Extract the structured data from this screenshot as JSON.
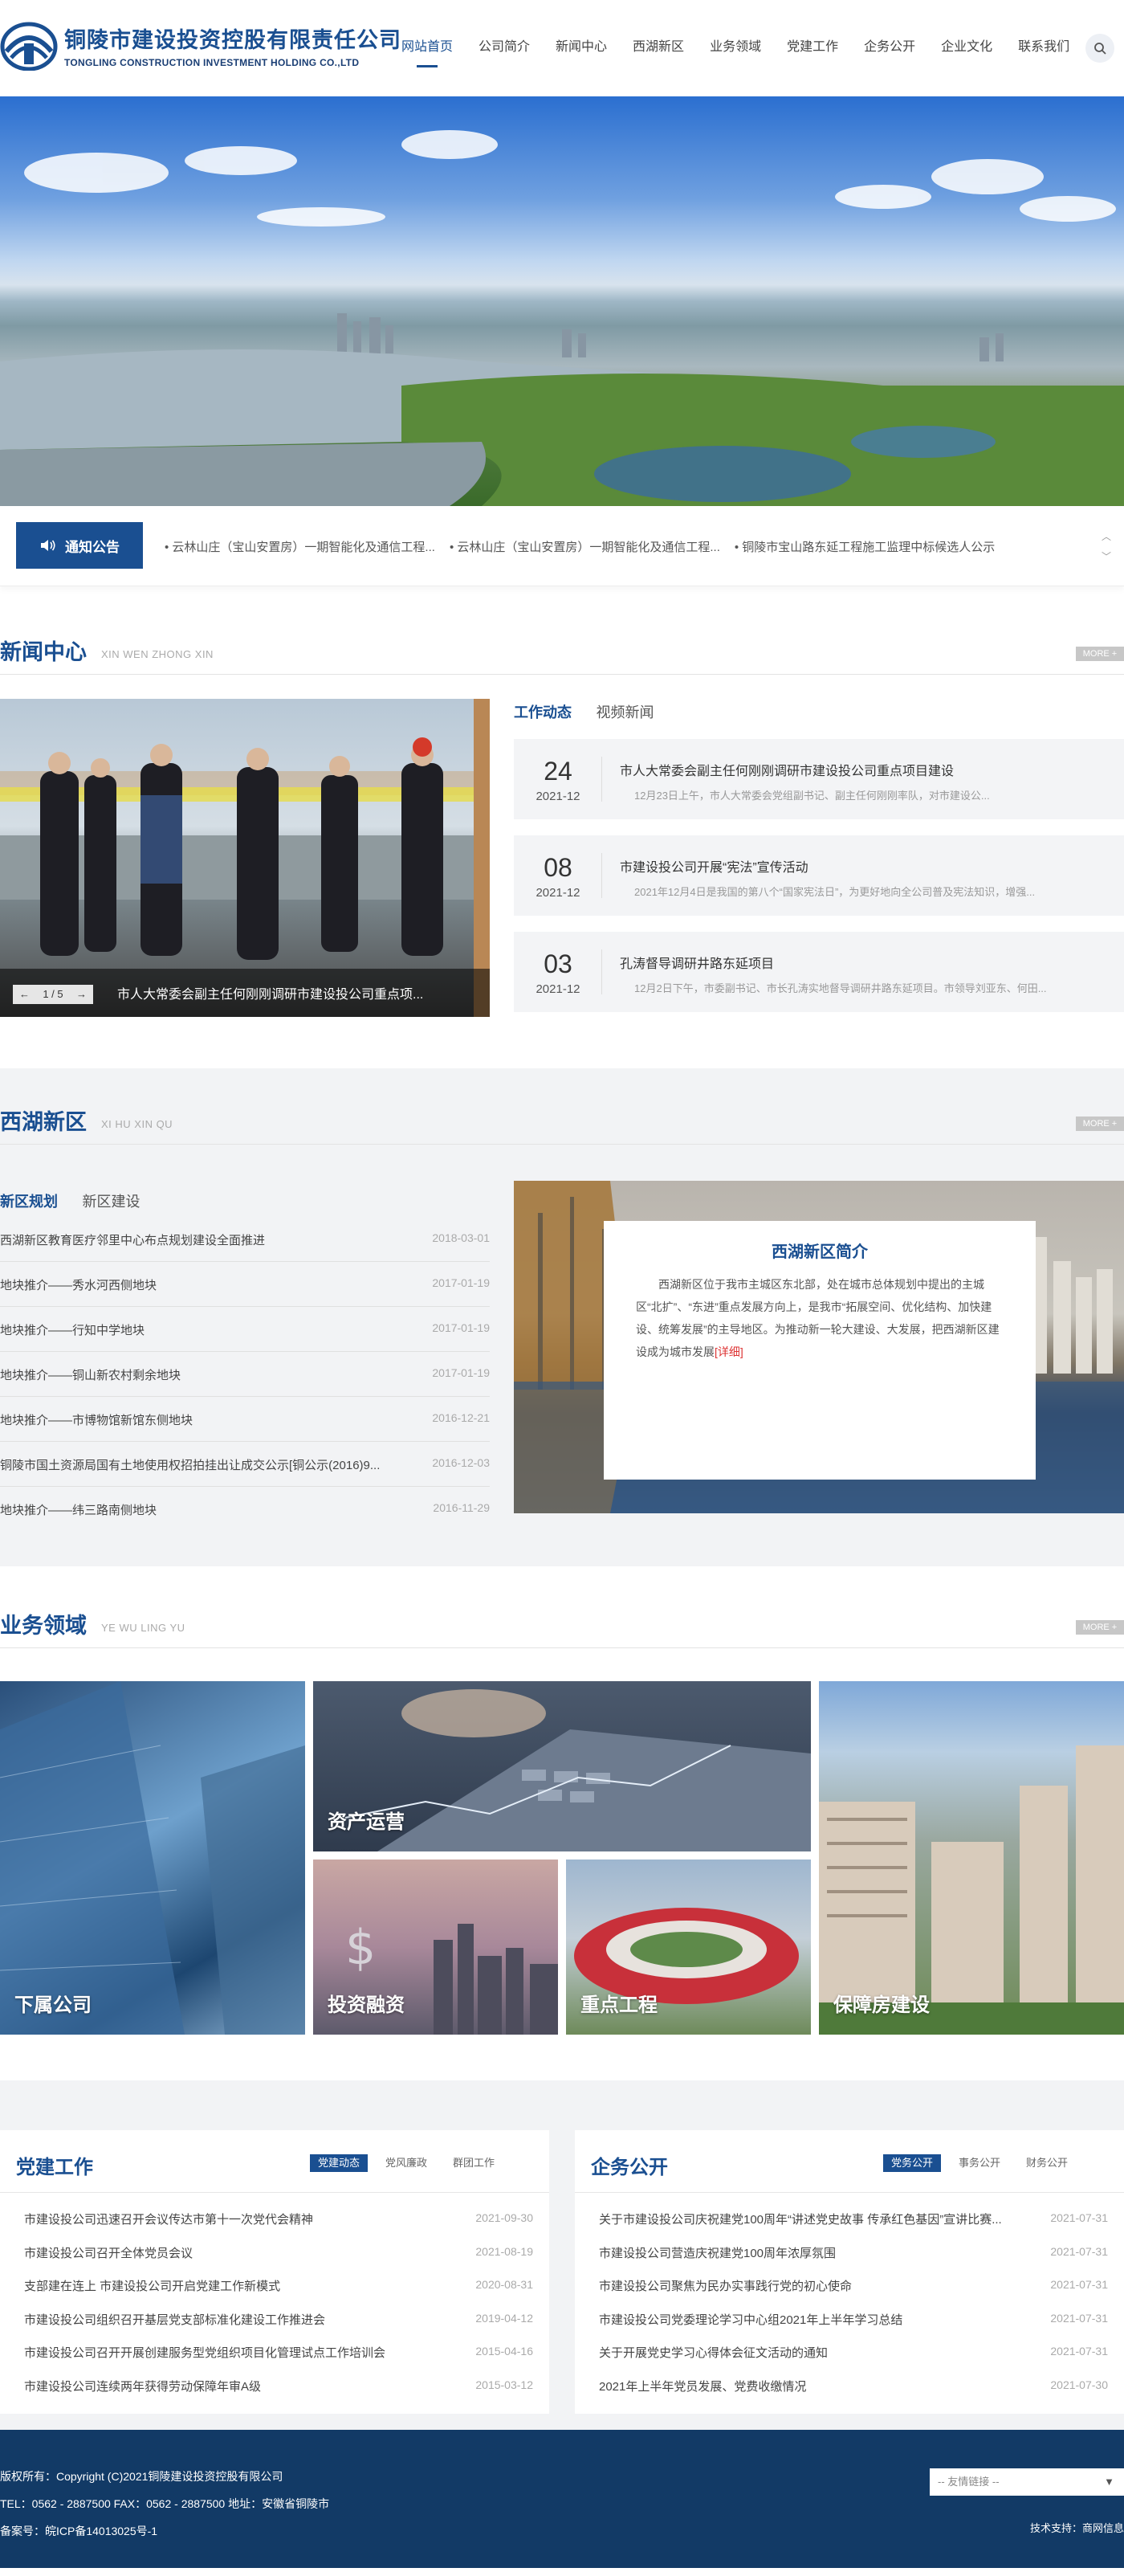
{
  "header": {
    "logo_cn": "铜陵市建设投资控股有限责任公司",
    "logo_en": "TONGLING CONSTRUCTION INVESTMENT HOLDING CO.,LTD",
    "nav": [
      "网站首页",
      "公司简介",
      "新闻中心",
      "西湖新区",
      "业务领域",
      "党建工作",
      "企务公开",
      "企业文化",
      "联系我们"
    ],
    "active_nav": "网站首页",
    "search_icon": "search-icon"
  },
  "banner": {
    "slides": 2,
    "active_slide": 1
  },
  "notice": {
    "label": "通知公告",
    "items": [
      "• 云林山庄（宝山安置房）一期智能化及通信工程...",
      "• 云林山庄（宝山安置房）一期智能化及通信工程...",
      "• 铜陵市宝山路东延工程施工监理中标候选人公示"
    ]
  },
  "news": {
    "title": "新闻中心",
    "sub": "XIN WEN ZHONG XIN",
    "more": "MORE +",
    "photo_pager": "1 / 5",
    "photo_caption": "市人大常委会副主任何刚刚调研市建设投公司重点项...",
    "tabs": [
      "工作动态",
      "视频新闻"
    ],
    "items": [
      {
        "day": "24",
        "ym": "2021-12",
        "title": "市人大常委会副主任何刚刚调研市建设投公司重点项目建设",
        "desc": "12月23日上午，市人大常委会党组副书记、副主任何刚刚率队，对市建设公..."
      },
      {
        "day": "08",
        "ym": "2021-12",
        "title": "市建设投公司开展“宪法”宣传活动",
        "desc": "2021年12月4日是我国的第八个“国家宪法日”，为更好地向全公司普及宪法知识，增强..."
      },
      {
        "day": "03",
        "ym": "2021-12",
        "title": "孔涛督导调研井路东延项目",
        "desc": "12月2日下午，市委副书记、市长孔涛实地督导调研井路东延项目。市领导刘亚东、何田..."
      }
    ]
  },
  "xihu": {
    "title": "西湖新区",
    "sub": "XI HU XIN QU",
    "more": "MORE +",
    "tabs": [
      "新区规划",
      "新区建设"
    ],
    "items": [
      {
        "t": "西湖新区教育医疗邻里中心布点规划建设全面推进",
        "d": "2018-03-01"
      },
      {
        "t": "地块推介——秀水河西侧地块",
        "d": "2017-01-19"
      },
      {
        "t": "地块推介——行知中学地块",
        "d": "2017-01-19"
      },
      {
        "t": "地块推介——铜山新农村剩余地块",
        "d": "2017-01-19"
      },
      {
        "t": "地块推介——市博物馆新馆东侧地块",
        "d": "2016-12-21"
      },
      {
        "t": "铜陵市国土资源局国有土地使用权招拍挂出让成交公示[铜公示(2016)9...",
        "d": "2016-12-03"
      },
      {
        "t": "地块推介——纬三路南侧地块",
        "d": "2016-11-29"
      }
    ],
    "card_title": "西湖新区简介",
    "card_body": "西湖新区位于我市主城区东北部，处在城市总体规划中提出的主城区“北扩”、“东进”重点发展方向上，是我市“拓展空间、优化结构、加快建设、统筹发展”的主导地区。为推动新一轮大建设、大发展，把西湖新区建设成为城市发展",
    "card_more": "[详细]"
  },
  "business": {
    "title": "业务领域",
    "sub": "YE WU LING YU",
    "more": "MORE +",
    "tiles": [
      "下属公司",
      "资产运营",
      "投资融资",
      "重点工程",
      "保障房建设"
    ]
  },
  "party": {
    "title": "党建工作",
    "tabs": [
      "党建动态",
      "党风廉政",
      "群团工作"
    ],
    "items": [
      {
        "t": "市建设投公司迅速召开会议传达市第十一次党代会精神",
        "d": "2021-09-30"
      },
      {
        "t": "市建设投公司召开全体党员会议",
        "d": "2021-08-19"
      },
      {
        "t": "支部建在连上 市建设投公司开启党建工作新模式",
        "d": "2020-08-31"
      },
      {
        "t": "市建设投公司组织召开基层党支部标准化建设工作推进会",
        "d": "2019-04-12"
      },
      {
        "t": "市建设投公司召开开展创建服务型党组织项目化管理试点工作培训会",
        "d": "2015-04-16"
      },
      {
        "t": "市建设投公司连续两年获得劳动保障年审A级",
        "d": "2015-03-12"
      }
    ]
  },
  "affairs": {
    "title": "企务公开",
    "tabs": [
      "党务公开",
      "事务公开",
      "财务公开"
    ],
    "items": [
      {
        "t": "关于市建设投公司庆祝建党100周年“讲述党史故事 传承红色基因”宣讲比赛...",
        "d": "2021-07-31"
      },
      {
        "t": "市建设投公司营造庆祝建党100周年浓厚氛围",
        "d": "2021-07-31"
      },
      {
        "t": "市建设投公司聚焦为民办实事践行党的初心使命",
        "d": "2021-07-31"
      },
      {
        "t": "市建设投公司党委理论学习中心组2021年上半年学习总结",
        "d": "2021-07-31"
      },
      {
        "t": "关于开展党史学习心得体会征文活动的通知",
        "d": "2021-07-31"
      },
      {
        "t": "2021年上半年党员发展、党费收缴情况",
        "d": "2021-07-30"
      }
    ]
  },
  "footer": {
    "copyright": "版权所有：Copyright (C)2021铜陵建设投资控股有限公司",
    "contact": "TEL：0562 - 2887500   FAX：0562 - 2887500   地址：安徽省铜陵市",
    "icp": "备案号：皖ICP备14013025号-1",
    "links": "-- 友情链接 --",
    "tech": "技术支持：商网信息"
  },
  "colors": {
    "brand": "#1a4f91",
    "footer": "#123a66",
    "accent_dot": "#e8a23a"
  }
}
